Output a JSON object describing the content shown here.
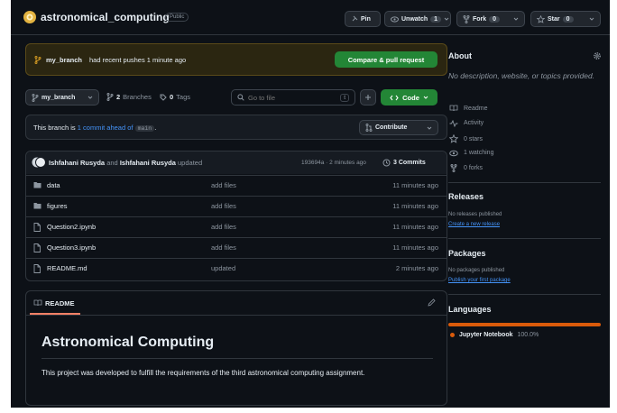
{
  "repo": {
    "name": "astronomical_computing",
    "visibility": "Public"
  },
  "header_buttons": {
    "pin": "Pin",
    "unwatch": "Unwatch",
    "watch_count": "1",
    "fork": "Fork",
    "fork_count": "0",
    "star": "Star",
    "star_count": "0"
  },
  "banner": {
    "branch": "my_branch",
    "message": "had recent pushes 1 minute ago",
    "button": "Compare & pull request"
  },
  "toolbar": {
    "branch": "my_branch",
    "branches_count": "2",
    "branches_label": "Branches",
    "tags_count": "0",
    "tags_label": "Tags",
    "search_placeholder": "Go to file",
    "search_key": "t",
    "code_button": "Code"
  },
  "ahead": {
    "prefix": "This branch is",
    "link": "1 commit ahead of",
    "base": "main",
    "suffix": ".",
    "contribute": "Contribute"
  },
  "commit": {
    "author1": "Ishfahani Rusyda",
    "and": "and",
    "author2": "Ishfahani Rusyda",
    "action": "updated",
    "meta": "193694a · 2 minutes ago",
    "commits_label": "3 Commits"
  },
  "files": [
    {
      "name": "data",
      "type": "folder",
      "message": "add files",
      "time": "11 minutes ago"
    },
    {
      "name": "figures",
      "type": "folder",
      "message": "add files",
      "time": "11 minutes ago"
    },
    {
      "name": "Question2.ipynb",
      "type": "file",
      "message": "add files",
      "time": "11 minutes ago"
    },
    {
      "name": "Question3.ipynb",
      "type": "file",
      "message": "add files",
      "time": "11 minutes ago"
    },
    {
      "name": "README.md",
      "type": "file",
      "message": "updated",
      "time": "2 minutes ago"
    }
  ],
  "readme": {
    "tab": "README",
    "title": "Astronomical Computing",
    "body": "This project was developed to fulfill the requirements of the third astronomical computing assignment."
  },
  "about": {
    "heading": "About",
    "description": "No description, website, or topics provided.",
    "items": [
      {
        "icon": "book-icon",
        "label": "Readme"
      },
      {
        "icon": "activity-icon",
        "label": "Activity"
      },
      {
        "icon": "star-icon",
        "label": "0 stars"
      },
      {
        "icon": "eye-icon",
        "label": "1 watching"
      },
      {
        "icon": "fork-icon",
        "label": "0 forks"
      }
    ]
  },
  "releases": {
    "heading": "Releases",
    "note": "No releases published",
    "link": "Create a new release"
  },
  "packages": {
    "heading": "Packages",
    "note": "No packages published",
    "link": "Publish your first package"
  },
  "languages": {
    "heading": "Languages",
    "items": [
      {
        "name": "Jupyter Notebook",
        "percent": "100.0%",
        "share": 1.0,
        "color": "#DA5B0B"
      }
    ]
  },
  "colors": {
    "accent_green": "#238636",
    "link_blue": "#4493f8",
    "background": "#0d1117",
    "border": "#30363d"
  }
}
